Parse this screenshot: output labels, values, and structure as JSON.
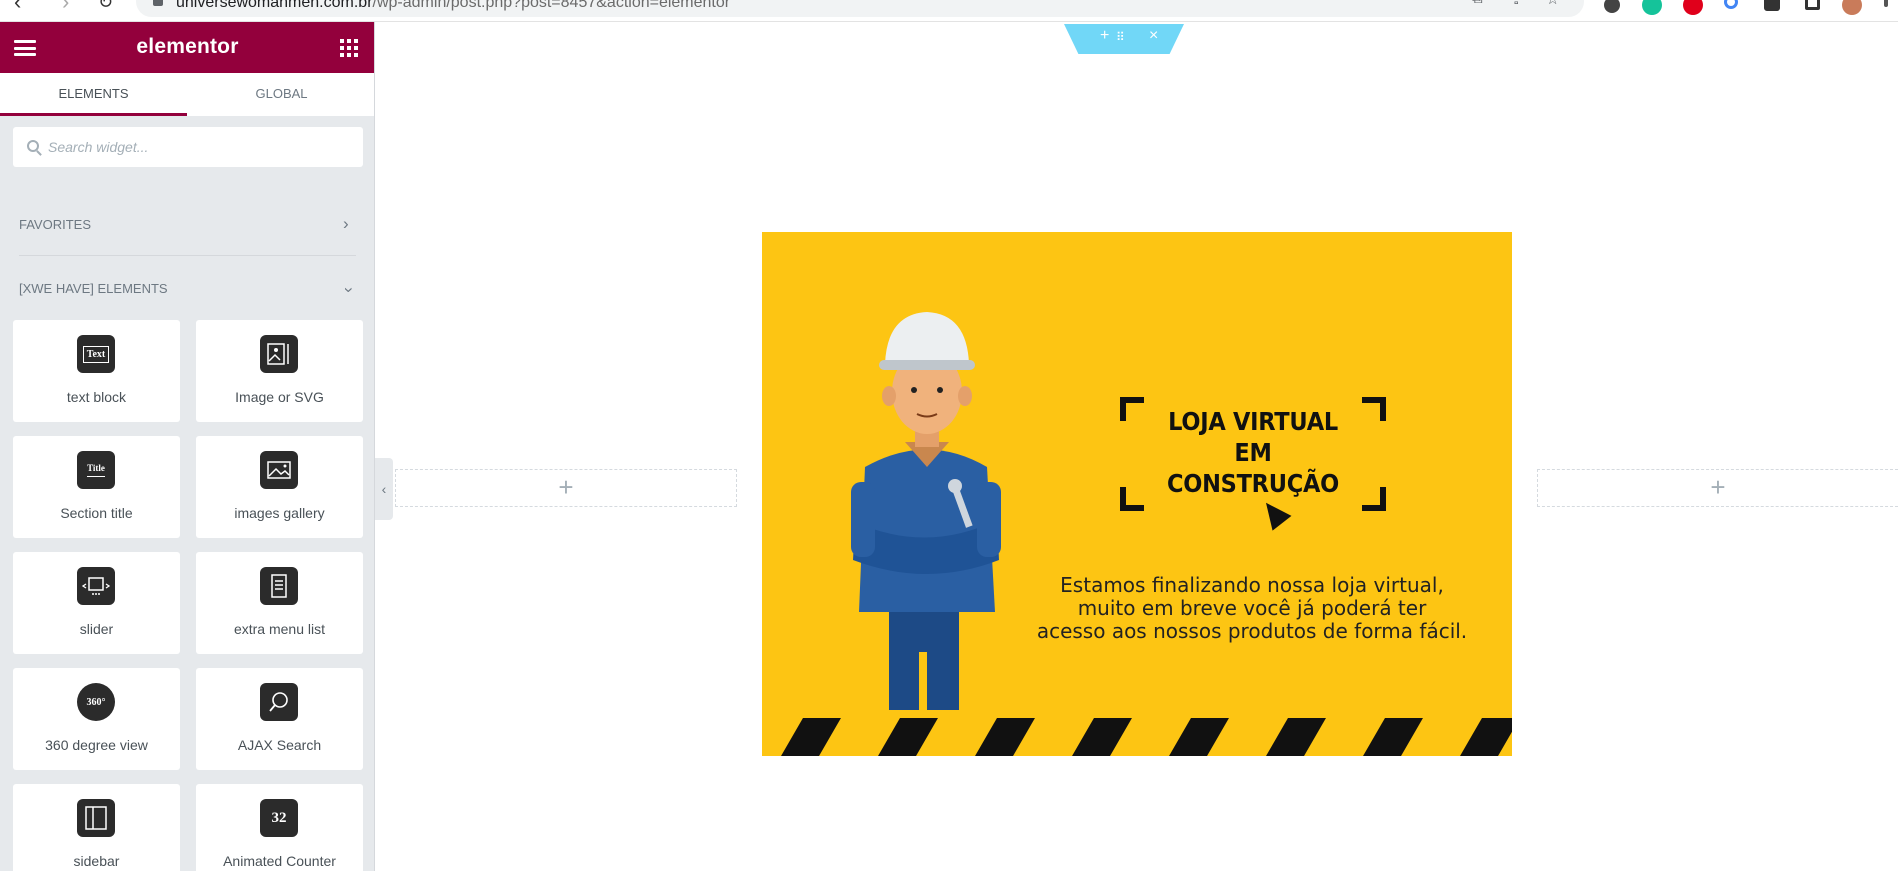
{
  "browser": {
    "url_host": "universewomanmen.com.br",
    "url_path": "/wp-admin/post.php?post=8457&action=elementor"
  },
  "panel": {
    "brand": "elementor",
    "tabs": [
      {
        "label": "ELEMENTS",
        "active": true
      },
      {
        "label": "GLOBAL",
        "active": false
      }
    ],
    "search_placeholder": "Search widget...",
    "categories": [
      {
        "label": "FAVORITES",
        "expanded": false
      },
      {
        "label": "[XWE HAVE] ELEMENTS",
        "expanded": true
      }
    ],
    "widgets": [
      {
        "label": "text block",
        "icon": "text-block-icon",
        "glyph": "Text"
      },
      {
        "label": "Image or SVG",
        "icon": "image-svg-icon",
        "glyph": ""
      },
      {
        "label": "Section title",
        "icon": "section-title-icon",
        "glyph": "Title"
      },
      {
        "label": "images gallery",
        "icon": "gallery-icon",
        "glyph": ""
      },
      {
        "label": "slider",
        "icon": "slider-icon",
        "glyph": ""
      },
      {
        "label": "extra menu list",
        "icon": "menu-list-icon",
        "glyph": ""
      },
      {
        "label": "360 degree view",
        "icon": "view-360-icon",
        "glyph": "360°"
      },
      {
        "label": "AJAX Search",
        "icon": "ajax-search-icon",
        "glyph": ""
      },
      {
        "label": "sidebar",
        "icon": "sidebar-icon",
        "glyph": ""
      },
      {
        "label": "Animated Counter",
        "icon": "counter-icon",
        "glyph": "32"
      }
    ]
  },
  "canvas": {
    "banner_title_lines": [
      "LOJA VIRTUAL",
      "EM",
      "CONSTRUÇÃO"
    ],
    "banner_text_lines": [
      "Estamos finalizando nossa loja virtual,",
      "muito em breve você já poderá ter",
      "acesso aos nossos produtos de forma fácil."
    ]
  },
  "colors": {
    "brand": "#93003c",
    "panel_bg": "#e6e9ec",
    "banner_yellow": "#fdc513",
    "handle_blue": "#71d7f7"
  }
}
